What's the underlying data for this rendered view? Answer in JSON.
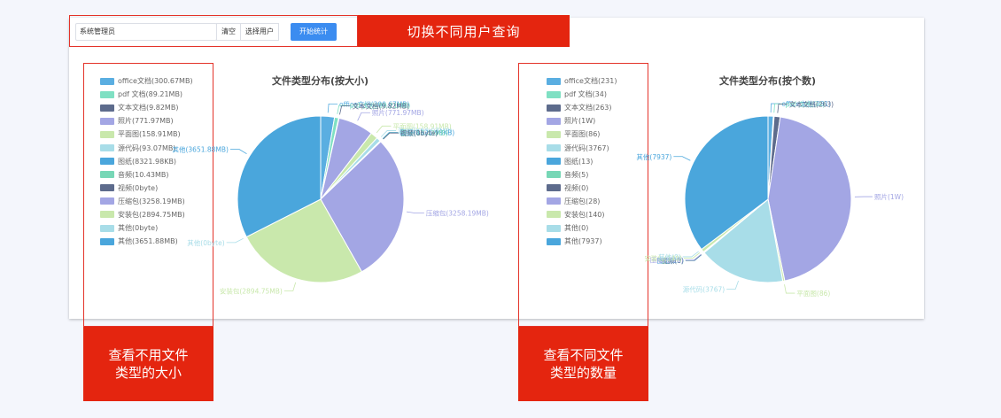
{
  "toolbar": {
    "user_value": "系统管理员",
    "clear_label": "清空",
    "select_user_label": "选择用户",
    "start_label": "开始统计"
  },
  "callouts": {
    "switch_user": "切换不同用户查询",
    "size_line1": "查看不用文件",
    "size_line2": "类型的大小",
    "count_line1": "查看不同文件",
    "count_line2": "类型的数量"
  },
  "colors": {
    "accent_red": "#e4250f",
    "primary_blue": "#3b8cf0"
  },
  "legend_size": [
    {
      "label": "office文档(300.67MB)",
      "color": "#5aaee1"
    },
    {
      "label": "pdf 文档(89.21MB)",
      "color": "#7fe0c3"
    },
    {
      "label": "文本文档(9.82MB)",
      "color": "#5d6b8c"
    },
    {
      "label": "照片(771.97MB)",
      "color": "#a3a6e4"
    },
    {
      "label": "平面图(158.91MB)",
      "color": "#c9e8ac"
    },
    {
      "label": "源代码(93.07MB)",
      "color": "#a8dde8"
    },
    {
      "label": "图纸(8321.98KB)",
      "color": "#4aa6dc"
    },
    {
      "label": "音频(10.43MB)",
      "color": "#77d7b6"
    },
    {
      "label": "视频(0byte)",
      "color": "#5d6b8c"
    },
    {
      "label": "压缩包(3258.19MB)",
      "color": "#a3a6e4"
    },
    {
      "label": "安装包(2894.75MB)",
      "color": "#c9e8ac"
    },
    {
      "label": "其他(0byte)",
      "color": "#a8dde8"
    },
    {
      "label": "其他(3651.88MB)",
      "color": "#4aa6dc"
    }
  ],
  "legend_count": [
    {
      "label": "office文档(231)",
      "color": "#5aaee1"
    },
    {
      "label": "pdf 文档(34)",
      "color": "#7fe0c3"
    },
    {
      "label": "文本文档(263)",
      "color": "#5d6b8c"
    },
    {
      "label": "照片(1W)",
      "color": "#a3a6e4"
    },
    {
      "label": "平面图(86)",
      "color": "#c9e8ac"
    },
    {
      "label": "源代码(3767)",
      "color": "#a8dde8"
    },
    {
      "label": "图纸(13)",
      "color": "#4aa6dc"
    },
    {
      "label": "音频(5)",
      "color": "#77d7b6"
    },
    {
      "label": "视频(0)",
      "color": "#5d6b8c"
    },
    {
      "label": "压缩包(28)",
      "color": "#a3a6e4"
    },
    {
      "label": "安装包(140)",
      "color": "#c9e8ac"
    },
    {
      "label": "其他(0)",
      "color": "#a8dde8"
    },
    {
      "label": "其他(7937)",
      "color": "#4aa6dc"
    }
  ],
  "chart_data": [
    {
      "type": "pie",
      "title": "文件类型分布(按大小)",
      "unit": "MB",
      "categories": [
        "office文档",
        "pdf 文档",
        "文本文档",
        "照片",
        "平面图",
        "源代码",
        "图纸",
        "音频",
        "视频",
        "压缩包",
        "安装包",
        "其他",
        "其他"
      ],
      "labels": [
        "office文档(300.67MB)",
        "pdf 文档(89.21MB)",
        "文本文档(9.82MB)",
        "照片(771.97MB)",
        "平面图(158.91MB)",
        "源代码(93.07MB)",
        "图纸(8321.98KB)",
        "音频(10.43MB)",
        "视频(0byte)",
        "压缩包(3258.19MB)",
        "安装包(2894.75MB)",
        "其他(0byte)",
        "其他(3651.88MB)"
      ],
      "values": [
        300.67,
        89.21,
        9.82,
        771.97,
        158.91,
        93.07,
        8.13,
        10.43,
        0,
        3258.19,
        2894.75,
        0,
        3651.88
      ],
      "legend": "left"
    },
    {
      "type": "pie",
      "title": "文件类型分布(按个数)",
      "categories": [
        "office文档",
        "pdf 文档",
        "文本文档",
        "照片",
        "平面图",
        "源代码",
        "图纸",
        "音频",
        "视频",
        "压缩包",
        "安装包",
        "其他",
        "其他"
      ],
      "labels": [
        "office文档(231)",
        "pdf 文档(34)",
        "文本文档(263)",
        "照片(1W)",
        "平面图(86)",
        "源代码(3767)",
        "图纸(13)",
        "音频(5)",
        "视频(0)",
        "压缩包(28)",
        "安装包(140)",
        "其他(0)",
        "其他(7937)"
      ],
      "values": [
        231,
        34,
        263,
        10000,
        86,
        3767,
        13,
        5,
        0,
        28,
        140,
        0,
        7937
      ],
      "legend": "left"
    }
  ]
}
